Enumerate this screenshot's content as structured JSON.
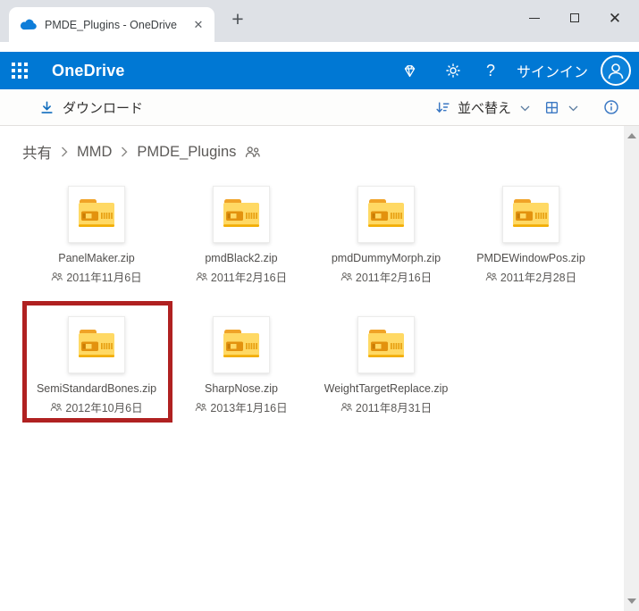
{
  "browser": {
    "tab_title": "PMDE_Plugins - OneDrive",
    "tab_close_glyph": "✕",
    "new_tab_glyph": "+",
    "window_close_glyph": "✕"
  },
  "header": {
    "brand": "OneDrive",
    "help_glyph": "?",
    "sign_in_label": "サインイン"
  },
  "toolbar": {
    "download_label": "ダウンロード",
    "sort_label": "並べ替え"
  },
  "breadcrumb": {
    "items": [
      "共有",
      "MMD",
      "PMDE_Plugins"
    ]
  },
  "files": [
    {
      "name": "PanelMaker.zip",
      "date": "2011年11月6日"
    },
    {
      "name": "pmdBlack2.zip",
      "date": "2011年2月16日"
    },
    {
      "name": "pmdDummyMorph.zip",
      "date": "2011年2月16日"
    },
    {
      "name": "PMDEWindowPos.zip",
      "date": "2011年2月28日"
    },
    {
      "name": "SemiStandardBones.zip",
      "date": "2012年10月6日"
    },
    {
      "name": "SharpNose.zip",
      "date": "2013年1月16日"
    },
    {
      "name": "WeightTargetReplace.zip",
      "date": "2011年8月31日"
    }
  ],
  "icons": {
    "app_launcher": "waffle-grid",
    "premium": "gem-outline",
    "settings": "gear",
    "account": "person-circle",
    "download": "arrow-down-to-line",
    "sort": "arrow-down-with-lines",
    "view": "grid-2x2",
    "info": "info-circle",
    "shared": "two-people",
    "file_type": "zip-folder"
  },
  "colors": {
    "accent": "#0078d4",
    "highlight_box": "#b02121",
    "folder_body": "#ffd964",
    "folder_tab": "#f0a328",
    "tabstrip_bg": "#dee1e6",
    "scroll_track": "#f0f0f0"
  }
}
